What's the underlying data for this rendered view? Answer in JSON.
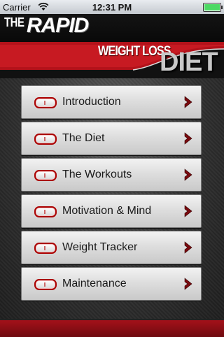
{
  "status_bar": {
    "carrier": "Carrier",
    "time": "12:31 PM",
    "wifi_icon": "wifi-icon",
    "battery_icon": "battery-icon"
  },
  "header": {
    "logo_the": "THE",
    "logo_rapid": "RAPID",
    "logo_weight_loss": "WEIGHT LOSS",
    "logo_diet": "DIET"
  },
  "menu": {
    "items": [
      {
        "label": "Introduction"
      },
      {
        "label": "The Diet"
      },
      {
        "label": "The Workouts"
      },
      {
        "label": "Motivation & Mind"
      },
      {
        "label": "Weight Tracker"
      },
      {
        "label": "Maintenance"
      }
    ],
    "item_icon": "pill-icon",
    "chevron_icon": "chevron-right-icon"
  },
  "colors": {
    "brand_red": "#b3121a",
    "chevron": "#7a0a0f"
  }
}
